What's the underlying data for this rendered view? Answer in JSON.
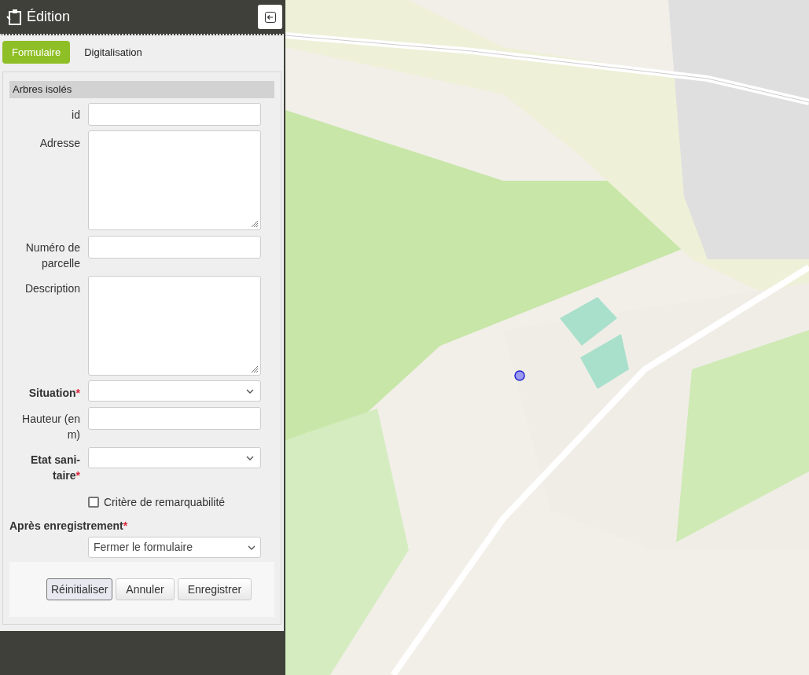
{
  "panel": {
    "title": "Édition"
  },
  "tabs": [
    {
      "label": "Formulaire",
      "selected": true
    },
    {
      "label": "Digitalisation",
      "selected": false
    }
  ],
  "form": {
    "section": "Arbres isolés",
    "fields": [
      {
        "kind": "input",
        "label": "id"
      },
      {
        "kind": "textarea",
        "label": "Adresse"
      },
      {
        "kind": "input",
        "label": "Numéro de parcelle"
      },
      {
        "kind": "textarea",
        "label": "Description"
      },
      {
        "kind": "select",
        "label": "Situation",
        "required_mark": "*"
      },
      {
        "kind": "input",
        "label": "Hauteur (en m)"
      },
      {
        "kind": "select",
        "label": "Etat sani-taire",
        "required_mark": "*"
      },
      {
        "kind": "checkbox",
        "label": "Critère de remarquabilité",
        "checked": false
      }
    ],
    "after_save": {
      "label": "Après enregistrement",
      "required_mark": "*",
      "value": "Fermer le formulaire"
    },
    "buttons": [
      {
        "label": "Réinitialiser",
        "focused": true
      },
      {
        "label": "Annuler",
        "focused": false
      },
      {
        "label": "Enregistrer",
        "focused": false
      }
    ]
  }
}
